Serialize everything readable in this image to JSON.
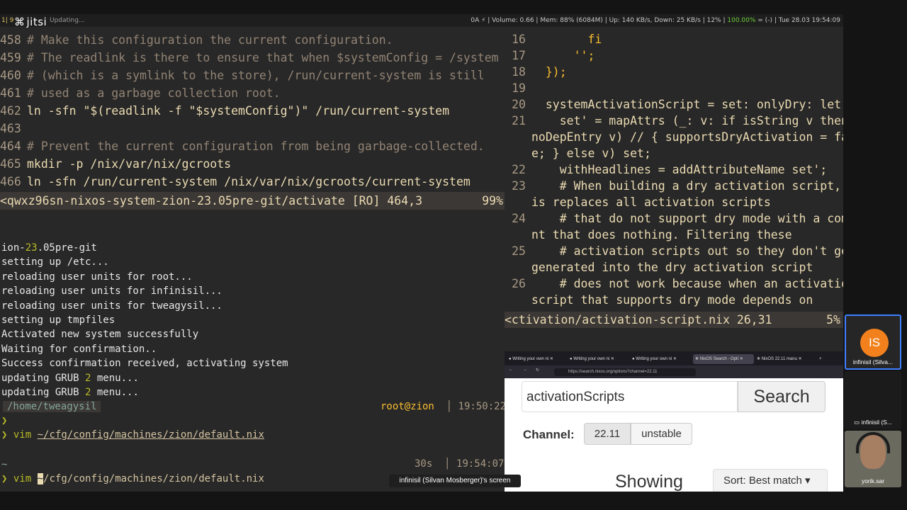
{
  "app": {
    "name": "jitsi"
  },
  "topbar": {
    "workspace": "1| 9",
    "updating": "Updating...",
    "status_prefix": "0A ⚡ | Volume: 0.66 | Mem: 88% (6084M) | Up: 140 KB/s, Down: 25 KB/s | 12% | ",
    "battery": "100.00%",
    "status_suffix": " = (-) | Tue 28.03 19:54:09"
  },
  "left_vim": {
    "lines": [
      {
        "n": "458",
        "t": "# Make this configuration the current configuration.",
        "k": "cm"
      },
      {
        "n": "459",
        "t": "# The readlink is there to ensure that when $systemConfig = /system",
        "k": "cm"
      },
      {
        "n": "460",
        "t": "# (which is a symlink to the store), /run/current-system is still",
        "k": "cm"
      },
      {
        "n": "461",
        "t": "# used as a garbage collection root.",
        "k": "cm"
      },
      {
        "n": "462",
        "t": "ln -sfn \"$(readlink -f \"$systemConfig\")\" /run/current-system",
        "k": "cmd"
      },
      {
        "n": "463",
        "t": "",
        "k": "cmd"
      },
      {
        "n": "464",
        "t": "# Prevent the current configuration from being garbage-collected.",
        "k": "cm"
      },
      {
        "n": "465",
        "t": "mkdir -p /nix/var/nix/gcroots",
        "k": "cmd"
      },
      {
        "n": "466",
        "t": "ln -sfn /run/current-system /nix/var/nix/gcroots/current-system",
        "k": "cmd"
      }
    ],
    "status": "<qwxz96sn-nixos-system-zion-23.05pre-git/activate [RO] 464,3",
    "percent": "99%"
  },
  "right_vim": {
    "lines": [
      {
        "n": "16",
        "t": "        fi"
      },
      {
        "n": "17",
        "t": "      '';"
      },
      {
        "n": "18",
        "t": "  });"
      },
      {
        "n": "19",
        "t": ""
      },
      {
        "n": "20",
        "t": "  systemActivationScript = set: onlyDry: let"
      },
      {
        "n": "21",
        "t": "    set' = mapAttrs (_: v: if isString v then ("
      },
      {
        "n": "",
        "t": "noDepEntry v) // { supportsDryActivation = fals"
      },
      {
        "n": "",
        "t": "e; } else v) set;"
      },
      {
        "n": "22",
        "t": "    withHeadlines = addAttributeName set';"
      },
      {
        "n": "23",
        "t": "    # When building a dry activation script, th"
      },
      {
        "n": "",
        "t": "is replaces all activation scripts"
      },
      {
        "n": "24",
        "t": "    # that do not support dry mode with a comme"
      },
      {
        "n": "",
        "t": "nt that does nothing. Filtering these"
      },
      {
        "n": "25",
        "t": "    # activation scripts out so they don't get"
      },
      {
        "n": "",
        "t": "generated into the dry activation script"
      },
      {
        "n": "26",
        "t": "    # does not work because when an activation"
      },
      {
        "n": "",
        "t": "script that supports dry mode depends on"
      }
    ],
    "status": "<ctivation/activation-script.nix 26,31",
    "percent": "5%"
  },
  "terminal": {
    "lines": [
      {
        "t": "ion-",
        "n": "23",
        "r": ".05pre-git"
      },
      {
        "t": "setting up /etc..."
      },
      {
        "t": "reloading user units for root..."
      },
      {
        "t": "reloading user units for infinisil..."
      },
      {
        "t": "reloading user units for tweagysil..."
      },
      {
        "t": "setting up tmpfiles"
      },
      {
        "t": "Activated new system successfully"
      },
      {
        "t": "Waiting for confirmation.."
      },
      {
        "t": "Success confirmation received, activating system"
      },
      {
        "t": "updating GRUB ",
        "n": "2",
        "r": " menu..."
      },
      {
        "t": "updating GRUB ",
        "n": "2",
        "r": " menu..."
      }
    ],
    "prompt1_path": "/home/tweagysil",
    "prompt1_user": "root@zion",
    "prompt1_time": "19:50:22",
    "arrow": "❯",
    "cmd_vim": "vim",
    "cmd_path": "~/cfg/config/machines/zion/default.nix",
    "prompt2_path": "~",
    "prompt2_dur": "30s",
    "prompt2_time": "19:54:07",
    "cmd2_cursor": "~",
    "cmd2_rest": "/cfg/config/machines/zion/default.nix"
  },
  "browser": {
    "tabs": [
      "Writing your own ni",
      "Writing your own ni",
      "Writing your own ni",
      "NixOS Search - Opti",
      "NixOS 22.11 manu"
    ],
    "url": "https://search.nixos.org/options?channel=22.11",
    "search_value": "activationScripts",
    "search_button": "Search",
    "channel_label": "Channel:",
    "channels": [
      "22.11",
      "unstable"
    ],
    "showing": "Showing",
    "sort": "Sort: Best match"
  },
  "sidebar": {
    "p1_initials": "IS",
    "p1_name": "infinisil (Silva...",
    "p2_name": "infinisil (S...",
    "p3_name": "yorik.sar"
  },
  "tooltip": "infinisil (Silvan Mosberger)'s screen"
}
